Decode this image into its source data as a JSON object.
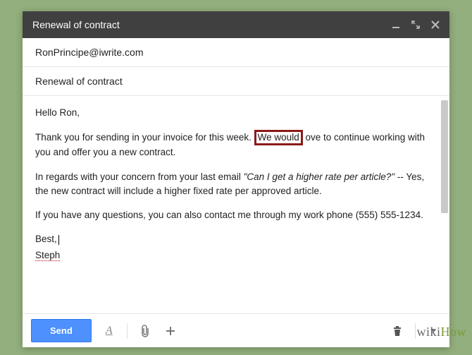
{
  "header": {
    "title": "Renewal of contract"
  },
  "fields": {
    "to": "RonPrincipe@iwrite.com",
    "subject": "Renewal of contract"
  },
  "body": {
    "greeting": "Hello Ron,",
    "p1a": "Thank you for sending in your invoice for this week. ",
    "p1_hl": "We would",
    "p1b": " ove to continue working with you and offer you a new contract.",
    "p2a": "In regards with your concern from your last email ",
    "p2_quote": "\"Can I get a higher rate per article?\"",
    "p2b": " -- Yes, the new contract will include a higher fixed rate per approved article.",
    "p3": "If you have any questions, you can also contact me through my work phone (555) 555-1234.",
    "signoff": "Best,",
    "name": "Steph"
  },
  "toolbar": {
    "send_label": "Send"
  },
  "watermark": {
    "wiki": "wiki",
    "how": "How"
  }
}
